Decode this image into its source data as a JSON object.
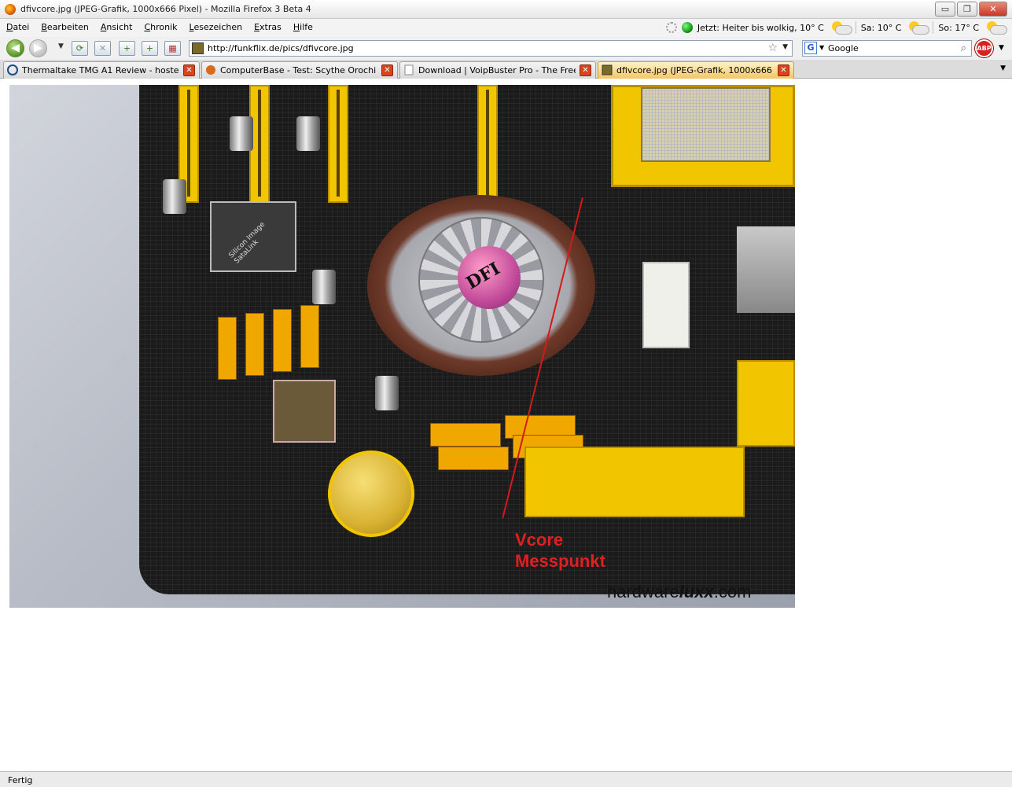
{
  "window": {
    "title": "dfivcore.jpg (JPEG-Grafik, 1000x666 Pixel) - Mozilla Firefox 3 Beta 4",
    "controls": {
      "minimize": "▭",
      "maximize": "❐",
      "close": "✕"
    }
  },
  "menu": {
    "items": [
      "Datei",
      "Bearbeiten",
      "Ansicht",
      "Chronik",
      "Lesezeichen",
      "Extras",
      "Hilfe"
    ]
  },
  "weather": {
    "now": "Jetzt: Heiter bis wolkig, 10° C",
    "sat": "Sa: 10° C",
    "sun": "So: 17° C"
  },
  "nav": {
    "url": "http://funkflix.de/pics/dfivcore.jpg",
    "search_value": "Google",
    "search_engine_letter": "G",
    "abp_label": "ABP"
  },
  "tabs": [
    {
      "label": "Thermaltake TMG A1 Review - hosted ...",
      "active": false
    },
    {
      "label": "ComputerBase - Test: Scythe Orochi C...",
      "active": false
    },
    {
      "label": "Download | VoipBuster Pro - The Free ...",
      "active": false
    },
    {
      "label": "dfivcore.jpg (JPEG-Grafik, 1000x666 Pi...",
      "active": true
    }
  ],
  "image": {
    "fan_logo": "DFI",
    "chip_label": "Silicon Image SataLink",
    "annotation_line1": "Vcore",
    "annotation_line2": "Messpunkt",
    "watermark_pre": "hardware",
    "watermark_bold": "luxx",
    "watermark_post": ".com"
  },
  "status": {
    "text": "Fertig"
  },
  "colors": {
    "annotation": "#e02020",
    "board_yellow": "#f1c500",
    "tab_active": "#f2c766"
  }
}
